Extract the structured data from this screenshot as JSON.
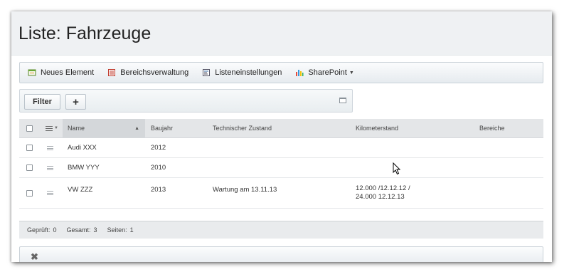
{
  "page": {
    "title": "Liste: Fahrzeuge"
  },
  "toolbar": {
    "items": [
      {
        "label": "Neues Element",
        "icon": "new-item-icon"
      },
      {
        "label": "Bereichsverwaltung",
        "icon": "list-icon"
      },
      {
        "label": "Listeneinstellungen",
        "icon": "settings-icon"
      },
      {
        "label": "SharePoint",
        "icon": "sharepoint-icon"
      }
    ]
  },
  "filter": {
    "filter_label": "Filter",
    "add_label": "+"
  },
  "grid": {
    "columns": {
      "name": "Name",
      "baujahr": "Baujahr",
      "zustand": "Technischer Zustand",
      "km": "Kilometerstand",
      "bereiche": "Bereiche"
    },
    "rows": [
      {
        "name": "Audi XXX",
        "baujahr": "2012",
        "zustand": "",
        "km_line1": "",
        "km_line2": "",
        "bereiche": ""
      },
      {
        "name": "BMW YYY",
        "baujahr": "2010",
        "zustand": "",
        "km_line1": "",
        "km_line2": "",
        "bereiche": ""
      },
      {
        "name": "VW ZZZ",
        "baujahr": "2013",
        "zustand": "Wartung am 13.11.13",
        "km_line1": "12.000 /12.12.12 /",
        "km_line2": "24.000 12.12.13",
        "bereiche": ""
      }
    ]
  },
  "footer": {
    "checked_label": "Geprüft:",
    "checked_value": "0",
    "total_label": "Gesamt:",
    "total_value": "3",
    "pages_label": "Seiten:",
    "pages_value": "1"
  },
  "colors": {
    "title_bg": "#eff1f3",
    "header_bg": "#e4e6e8",
    "footer_bg": "#e9ebed"
  }
}
